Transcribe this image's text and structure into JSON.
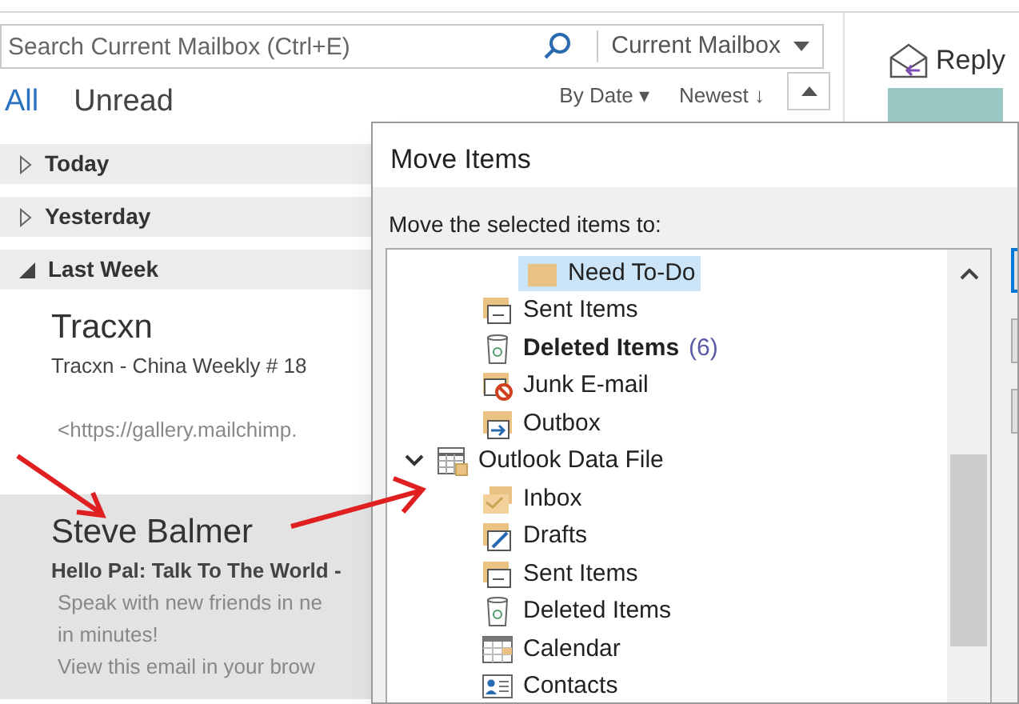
{
  "search": {
    "placeholder": "Search Current Mailbox (Ctrl+E)",
    "scope": "Current Mailbox"
  },
  "filters": [
    {
      "label": "All",
      "selected": true
    },
    {
      "label": "Unread",
      "selected": false
    }
  ],
  "sort": {
    "by": "By Date ▾",
    "order": "Newest ↓"
  },
  "reply": "Reply",
  "groups": [
    {
      "label": "Today",
      "expanded": false
    },
    {
      "label": "Yesterday",
      "expanded": false
    },
    {
      "label": "Last Week",
      "expanded": true,
      "emails": [
        {
          "sender": "Tracxn",
          "subject": "Tracxn - China Weekly # 18",
          "preview": [
            "<https://gallery.mailchimp."
          ],
          "selected": false
        },
        {
          "sender": "Steve Balmer",
          "subject": "Hello Pal: Talk To The World -",
          "preview": [
            "Speak with new friends in ne",
            "in minutes!",
            "View this email in your brow"
          ],
          "selected": true
        }
      ]
    }
  ],
  "dialog": {
    "title": "Move Items",
    "prompt": "Move the selected items to:",
    "tree": [
      {
        "children": [
          {
            "children": [
              {
                "label": "Need To-Do",
                "kind": "plain",
                "selected": true
              }
            ]
          },
          {
            "label": "Sent Items",
            "kind": "sent",
            "selected": false
          },
          {
            "label": "Deleted Items",
            "kind": "deleted",
            "selected": false,
            "bold": true,
            "count": "(6)"
          },
          {
            "label": "Junk E-mail",
            "kind": "junk",
            "selected": false
          },
          {
            "label": "Outbox",
            "kind": "outbox",
            "selected": false
          }
        ]
      },
      {
        "label": "Outlook Data File",
        "kind": "datafile",
        "selected": false,
        "expanded": true,
        "children": [
          {
            "label": "Inbox",
            "kind": "inbox",
            "selected": false
          },
          {
            "label": "Drafts",
            "kind": "drafts",
            "selected": false
          },
          {
            "label": "Sent Items",
            "kind": "sent",
            "selected": false
          },
          {
            "label": "Deleted Items",
            "kind": "deleted",
            "selected": false
          },
          {
            "label": "Calendar",
            "kind": "calendar",
            "selected": false
          },
          {
            "label": "Contacts",
            "kind": "contacts",
            "selected": false
          }
        ]
      }
    ]
  }
}
